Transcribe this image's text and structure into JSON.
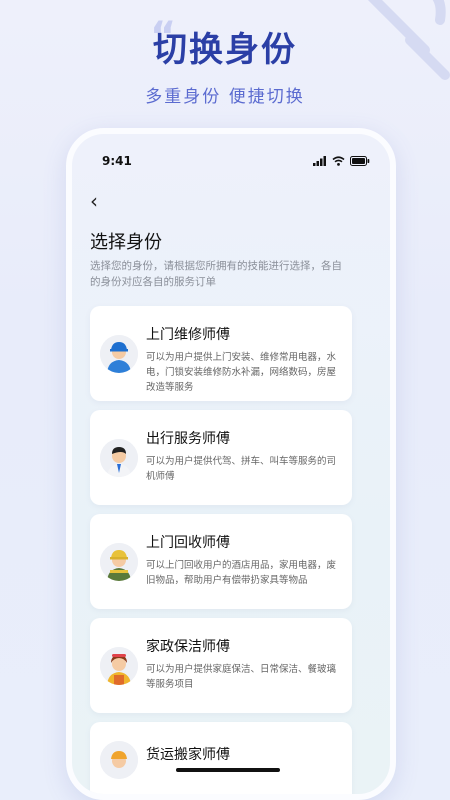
{
  "hero": {
    "title": "切换身份",
    "subtitle": "多重身份  便捷切换"
  },
  "status_bar": {
    "time": "9:41"
  },
  "page": {
    "title": "选择身份",
    "description": "选择您的身份，请根据您所拥有的技能进行选择，各自的身份对应各自的服务订单"
  },
  "identities": [
    {
      "title": "上门维修师傅",
      "desc": "可以为用户提供上门安装、维修常用电器，水电，门锁安装维修防水补漏，网络数码，房屋改造等服务",
      "icon": "repairman-avatar-icon"
    },
    {
      "title": "出行服务师傅",
      "desc": "可以为用户提供代驾、拼车、叫车等服务的司机师傅",
      "icon": "driver-avatar-icon"
    },
    {
      "title": "上门回收师傅",
      "desc": "可以上门回收用户的酒店用品，家用电器，废旧物品，帮助用户有偿带扔家具等物品",
      "icon": "recycler-avatar-icon"
    },
    {
      "title": "家政保洁师傅",
      "desc": "可以为用户提供家庭保洁、日常保洁、餐玻璃等服务项目",
      "icon": "cleaner-avatar-icon"
    },
    {
      "title": "货运搬家师傅",
      "desc": "",
      "icon": "mover-avatar-icon"
    }
  ],
  "colors": {
    "brand": "#2b3fa6",
    "accent": "#5b6bd0"
  }
}
